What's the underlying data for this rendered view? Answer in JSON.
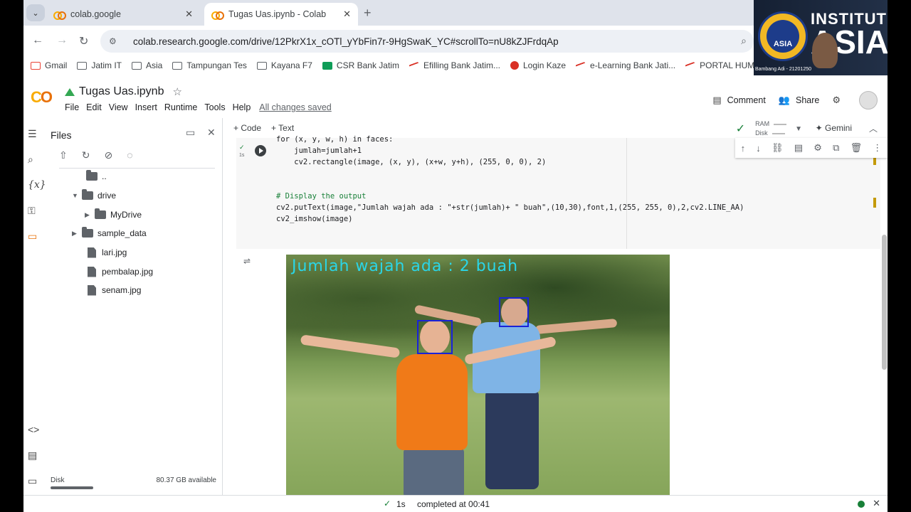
{
  "browser": {
    "tabs": [
      {
        "title": "colab.google"
      },
      {
        "title": "Tugas Uas.ipynb - Colab"
      }
    ],
    "url": "colab.research.google.com/drive/12PkrX1x_cOTl_yYbFin7r-9HgSwaK_YC#scrollTo=nU8kZJFrdqAp",
    "bookmarks": [
      {
        "label": "Gmail"
      },
      {
        "label": "Jatim IT"
      },
      {
        "label": "Asia"
      },
      {
        "label": "Tampungan Tes"
      },
      {
        "label": "Kayana F7"
      },
      {
        "label": "CSR Bank Jatim"
      },
      {
        "label": "Efilling Bank Jatim..."
      },
      {
        "label": "Login Kaze"
      },
      {
        "label": "e-Learning Bank Jati..."
      },
      {
        "label": "PORTAL HUMAN C..."
      }
    ]
  },
  "colab": {
    "notebook_title": "Tugas Uas.ipynb",
    "menu": [
      "File",
      "Edit",
      "View",
      "Insert",
      "Runtime",
      "Tools",
      "Help"
    ],
    "save_status": "All changes saved",
    "comment_label": "Comment",
    "share_label": "Share"
  },
  "files_panel": {
    "title": "Files",
    "tree": [
      {
        "name": ".."
      },
      {
        "name": "drive"
      },
      {
        "name": "MyDrive"
      },
      {
        "name": "sample_data"
      },
      {
        "name": "lari.jpg"
      },
      {
        "name": "pembalap.jpg"
      },
      {
        "name": "senam.jpg"
      }
    ],
    "disk_label": "Disk",
    "disk_available": "80.37 GB available"
  },
  "toolbar": {
    "add_code": "+ Code",
    "add_text": "+ Text",
    "ram_label": "RAM",
    "disk_label": "Disk",
    "gemini": "Gemini"
  },
  "cell": {
    "exec_time": "1s",
    "code_lines": [
      "for (x, y, w, h) in faces:",
      "    jumlah=jumlah+1",
      "    cv2.rectangle(image, (x, y), (x+w, y+h), (255, 0, 0), 2)",
      "",
      "",
      "# Display the output",
      "cv2.putText(image,\"Jumlah wajah ada : \"+str(jumlah)+ \" buah\",(10,30),font,1,(255, 255, 0),2,cv2.LINE_AA)",
      "cv2_imshow(image)"
    ],
    "output_overlay_text": "Jumlah wajah ada : 2 buah"
  },
  "status": {
    "duration": "1s",
    "completed": "completed at 00:41"
  },
  "webcam": {
    "institution_line1": "INSTITUT",
    "institution_line2": "ASIA",
    "seal_text": "ASIA",
    "participant": "Bambang Adi - 21201250"
  },
  "colors": {
    "accent": "#e8710a",
    "success": "#188038",
    "overlay_text": "#2ad6e8",
    "face_box": "#1a22d8"
  }
}
